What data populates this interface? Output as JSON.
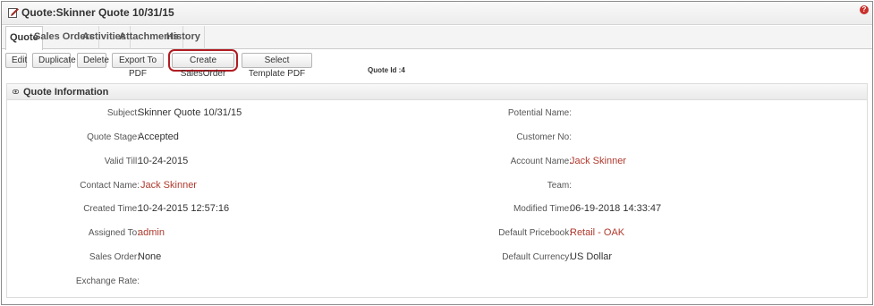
{
  "title": "Quote:Skinner Quote 10/31/15",
  "help_glyph": "?",
  "tabs": [
    "Quote",
    "Sales Orders",
    "Activities",
    "Attachments",
    "History"
  ],
  "toolbar": {
    "edit": "Edit",
    "duplicate": "Duplicate",
    "delete": "Delete",
    "export_pdf": "Export To PDF",
    "create_salesorder": "Create SalesOrder",
    "select_template_pdf": "Select Template PDF",
    "quote_id": "Quote Id :4"
  },
  "section": {
    "title": "Quote Information"
  },
  "fields": {
    "subject": {
      "label": "Subject:",
      "value": "Skinner Quote 10/31/15"
    },
    "quote_stage": {
      "label": "Quote Stage:",
      "value": "Accepted"
    },
    "valid_till": {
      "label": "Valid Till:",
      "value": "10-24-2015"
    },
    "contact_name": {
      "label": "Contact Name:",
      "value": "Jack Skinner"
    },
    "created_time": {
      "label": "Created Time:",
      "value": "10-24-2015 12:57:16"
    },
    "assigned_to": {
      "label": "Assigned To:",
      "value": "admin"
    },
    "sales_order": {
      "label": "Sales Order:",
      "value": "None"
    },
    "exchange_rate": {
      "label": "Exchange Rate:",
      "value": ""
    },
    "potential_name": {
      "label": "Potential Name:",
      "value": ""
    },
    "customer_no": {
      "label": "Customer No:",
      "value": ""
    },
    "account_name": {
      "label": "Account Name:",
      "value": "Jack Skinner"
    },
    "team": {
      "label": "Team:",
      "value": ""
    },
    "modified_time": {
      "label": "Modified Time:",
      "value": "06-19-2018 14:33:47"
    },
    "default_pricebook": {
      "label": "Default Pricebook:",
      "value": "Retail - OAK"
    },
    "default_currency": {
      "label": "Default Currency:",
      "value": "US Dollar"
    }
  },
  "colors": {
    "link": "#b03a2e",
    "highlight": "#b01c22"
  }
}
